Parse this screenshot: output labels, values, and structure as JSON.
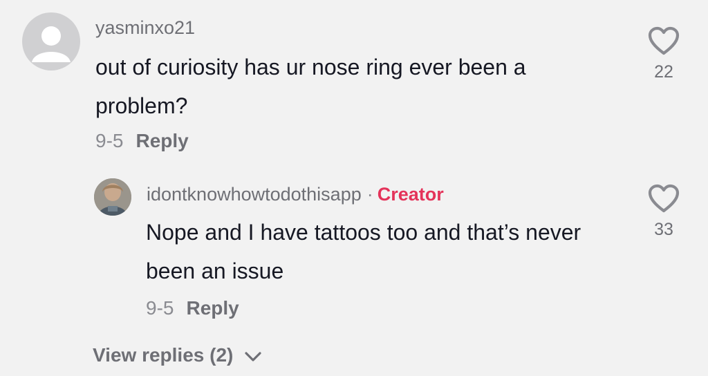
{
  "comment": {
    "username": "yasminxo21",
    "text": "out of curiosity has ur nose ring ever been a problem?",
    "date": "9-5",
    "reply_label": "Reply",
    "likes": "22"
  },
  "reply": {
    "username": "idontknowhowtodothisapp",
    "separator": "·",
    "badge": "Creator",
    "text": "Nope and I have tattoos too and that’s never been an issue",
    "date": "9-5",
    "reply_label": "Reply",
    "likes": "33"
  },
  "view_replies": {
    "label": "View replies (2)"
  },
  "icons": {
    "like": "heart-outline-icon",
    "expand": "chevron-down-icon",
    "default_avatar": "default-avatar-icon"
  },
  "colors": {
    "background": "#f2f2f2",
    "text": "#161823",
    "secondary": "#8a8b91",
    "creator_badge": "#e4335a"
  }
}
